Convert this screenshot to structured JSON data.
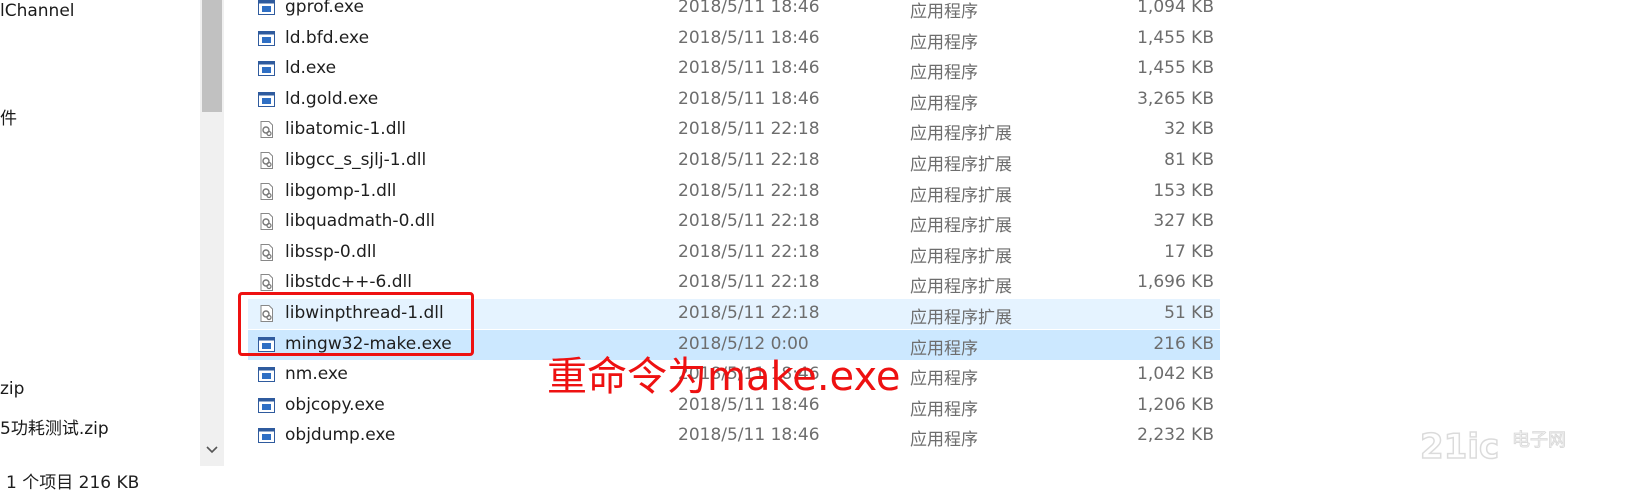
{
  "nav": {
    "items": [
      {
        "label": "lChannel"
      },
      {
        "label": "件"
      },
      {
        "label": "zip"
      },
      {
        "label": "5功耗测试.zip"
      }
    ]
  },
  "files": [
    {
      "name": "gprof.exe",
      "date": "2018/5/11 18:46",
      "type": "应用程序",
      "size": "1,094 KB",
      "icon": "exe-icon"
    },
    {
      "name": "ld.bfd.exe",
      "date": "2018/5/11 18:46",
      "type": "应用程序",
      "size": "1,455 KB",
      "icon": "exe-icon"
    },
    {
      "name": "ld.exe",
      "date": "2018/5/11 18:46",
      "type": "应用程序",
      "size": "1,455 KB",
      "icon": "exe-icon"
    },
    {
      "name": "ld.gold.exe",
      "date": "2018/5/11 18:46",
      "type": "应用程序",
      "size": "3,265 KB",
      "icon": "exe-icon"
    },
    {
      "name": "libatomic-1.dll",
      "date": "2018/5/11 22:18",
      "type": "应用程序扩展",
      "size": "32 KB",
      "icon": "dll-icon"
    },
    {
      "name": "libgcc_s_sjlj-1.dll",
      "date": "2018/5/11 22:18",
      "type": "应用程序扩展",
      "size": "81 KB",
      "icon": "dll-icon"
    },
    {
      "name": "libgomp-1.dll",
      "date": "2018/5/11 22:18",
      "type": "应用程序扩展",
      "size": "153 KB",
      "icon": "dll-icon"
    },
    {
      "name": "libquadmath-0.dll",
      "date": "2018/5/11 22:18",
      "type": "应用程序扩展",
      "size": "327 KB",
      "icon": "dll-icon"
    },
    {
      "name": "libssp-0.dll",
      "date": "2018/5/11 22:18",
      "type": "应用程序扩展",
      "size": "17 KB",
      "icon": "dll-icon"
    },
    {
      "name": "libstdc++-6.dll",
      "date": "2018/5/11 22:18",
      "type": "应用程序扩展",
      "size": "1,696 KB",
      "icon": "dll-icon"
    },
    {
      "name": "libwinpthread-1.dll",
      "date": "2018/5/11 22:18",
      "type": "应用程序扩展",
      "size": "51 KB",
      "icon": "dll-icon",
      "state": "hover"
    },
    {
      "name": "mingw32-make.exe",
      "date": "2018/5/12 0:00",
      "type": "应用程序",
      "size": "216 KB",
      "icon": "exe-icon",
      "state": "selected"
    },
    {
      "name": "nm.exe",
      "date": "2018/5/11 18:46",
      "type": "应用程序",
      "size": "1,042 KB",
      "icon": "exe-icon"
    },
    {
      "name": "objcopy.exe",
      "date": "2018/5/11 18:46",
      "type": "应用程序",
      "size": "1,206 KB",
      "icon": "exe-icon"
    },
    {
      "name": "objdump.exe",
      "date": "2018/5/11 18:46",
      "type": "应用程序",
      "size": "2,232 KB",
      "icon": "exe-icon"
    }
  ],
  "annotation": {
    "text": "重命令为make.exe",
    "color": "#ee1111"
  },
  "status": {
    "text": "1 个项目  216 KB"
  },
  "watermark": {
    "text": "21ic电子网"
  },
  "colors": {
    "hover": "#e5f3ff",
    "selected": "#cce8ff",
    "accent": "#ee1111"
  }
}
